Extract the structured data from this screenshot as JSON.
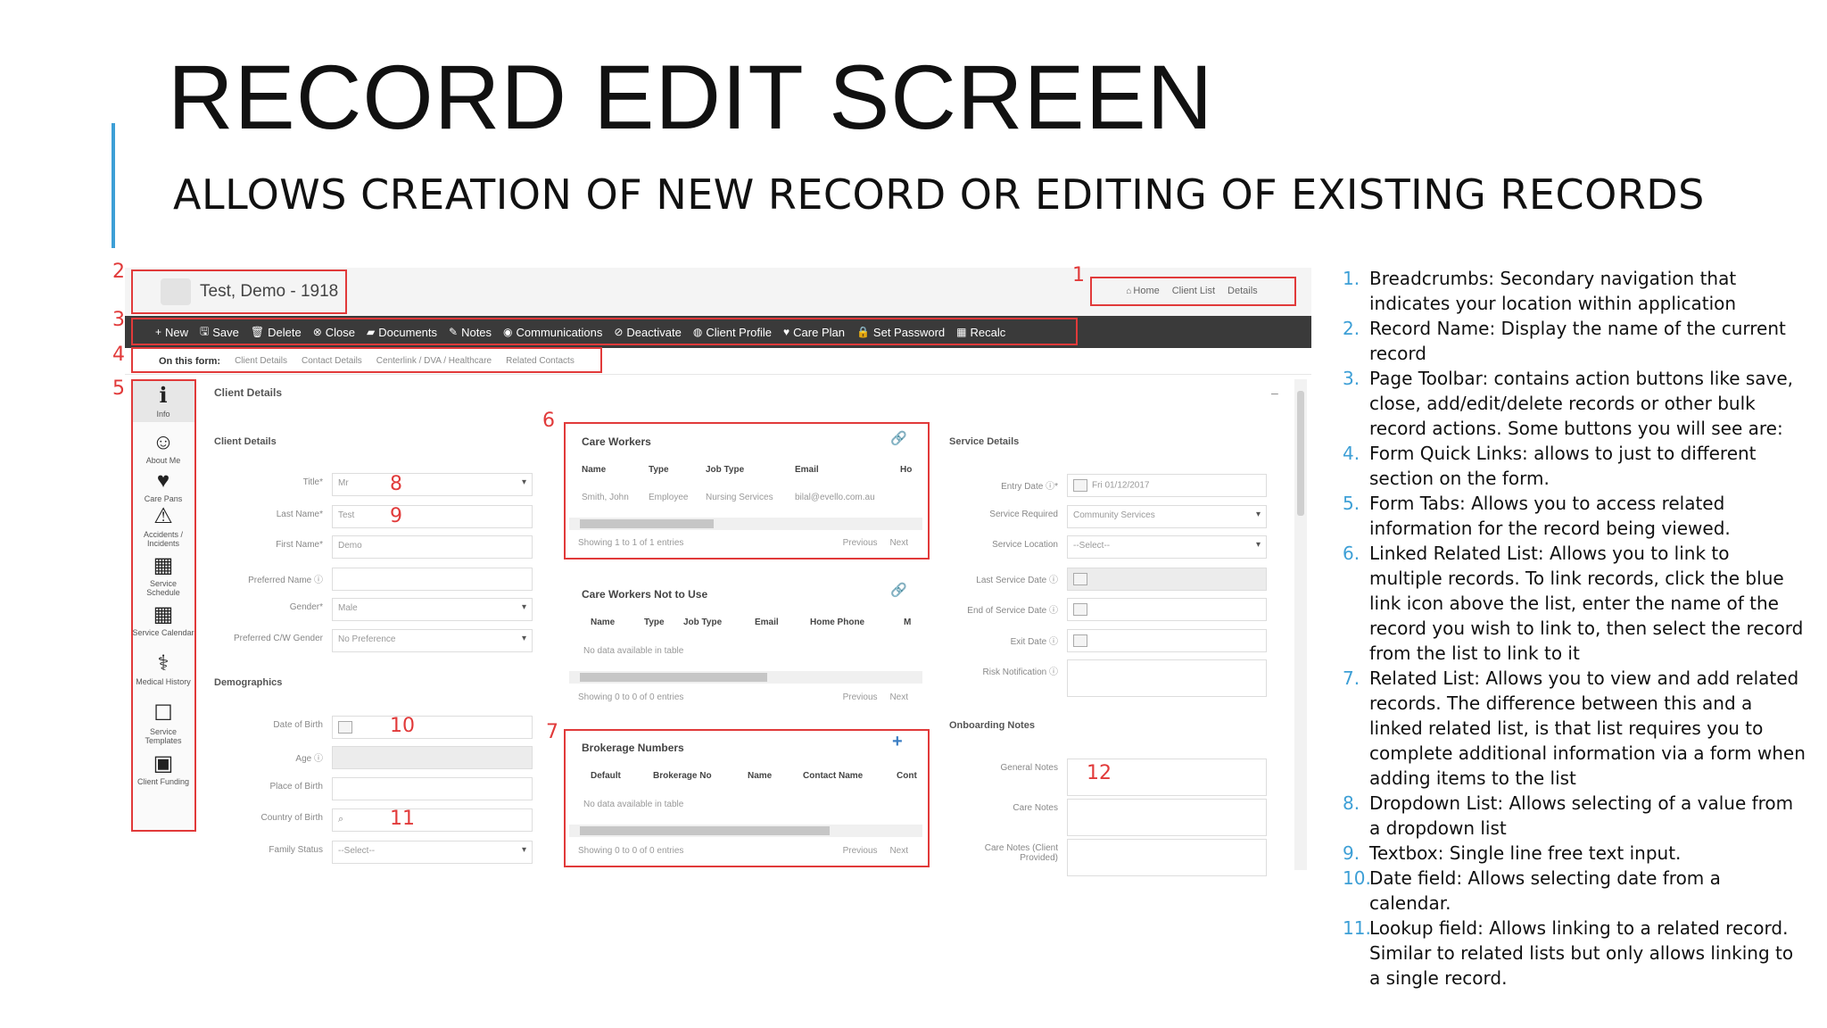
{
  "slide": {
    "title": "RECORD EDIT SCREEN",
    "subtitle": "ALLOWS CREATION OF NEW RECORD OR EDITING OF EXISTING RECORDS"
  },
  "record": {
    "name": "Test, Demo - 1918"
  },
  "breadcrumbs": [
    "Home",
    "Client List",
    "Details"
  ],
  "toolbar": [
    {
      "icon": "plus-icon",
      "glyph": "+",
      "label": "New"
    },
    {
      "icon": "save-icon",
      "glyph": "🖫",
      "label": "Save"
    },
    {
      "icon": "trash-icon",
      "glyph": "🗑",
      "label": "Delete"
    },
    {
      "icon": "close-circle-icon",
      "glyph": "⊗",
      "label": "Close"
    },
    {
      "icon": "folder-icon",
      "glyph": "▰",
      "label": "Documents"
    },
    {
      "icon": "edit-icon",
      "glyph": "✎",
      "label": "Notes"
    },
    {
      "icon": "chat-icon",
      "glyph": "◉",
      "label": "Communications"
    },
    {
      "icon": "ban-icon",
      "glyph": "⊘",
      "label": "Deactivate"
    },
    {
      "icon": "user-circle-icon",
      "glyph": "◍",
      "label": "Client Profile"
    },
    {
      "icon": "heart-icon",
      "glyph": "♥",
      "label": "Care Plan"
    },
    {
      "icon": "lock-icon",
      "glyph": "🔒",
      "label": "Set Password"
    },
    {
      "icon": "calculator-icon",
      "glyph": "▦",
      "label": "Recalc"
    }
  ],
  "quicklinks": {
    "label": "On this form:",
    "links": [
      "Client Details",
      "Contact Details",
      "Centerlink / DVA / Healthcare",
      "Related Contacts"
    ]
  },
  "tabs": [
    {
      "icon": "info-icon",
      "glyph": "ℹ",
      "label": "Info"
    },
    {
      "icon": "user-icon",
      "glyph": "☺",
      "label": "About Me"
    },
    {
      "icon": "heartbeat-icon",
      "glyph": "♥",
      "label": "Care Pans"
    },
    {
      "icon": "warning-icon",
      "glyph": "⚠",
      "label": "Accidents / Incidents"
    },
    {
      "icon": "calendar-icon",
      "glyph": "▦",
      "label": "Service Schedule"
    },
    {
      "icon": "calendar-grid-icon",
      "glyph": "▦",
      "label": "Service Calendar"
    },
    {
      "icon": "medical-icon",
      "glyph": "⚕",
      "label": "Medical History"
    },
    {
      "icon": "template-icon",
      "glyph": "☐",
      "label": "Service Templates"
    },
    {
      "icon": "money-icon",
      "glyph": "▣",
      "label": "Client Funding"
    }
  ],
  "client_details": {
    "panel_title": "Client Details",
    "section_title": "Client Details",
    "fields": [
      {
        "label": "Title*",
        "value": "Mr",
        "type": "select"
      },
      {
        "label": "Last Name*",
        "value": "Test",
        "type": "text"
      },
      {
        "label": "First Name*",
        "value": "Demo",
        "type": "text"
      },
      {
        "label": "Preferred Name ⓘ",
        "value": "",
        "type": "text"
      },
      {
        "label": "Gender*",
        "value": "Male",
        "type": "select"
      },
      {
        "label": "Preferred C/W Gender",
        "value": "No Preference",
        "type": "select"
      }
    ],
    "demographics_title": "Demographics",
    "demographics": [
      {
        "label": "Date of Birth",
        "value": "",
        "type": "date"
      },
      {
        "label": "Age ⓘ",
        "value": "",
        "type": "readonly"
      },
      {
        "label": "Place of Birth",
        "value": "",
        "type": "text"
      },
      {
        "label": "Country of Birth",
        "value": "",
        "type": "lookup"
      },
      {
        "label": "Family Status",
        "value": "--Select--",
        "type": "select"
      }
    ]
  },
  "care_workers": {
    "title": "Care Workers",
    "columns": [
      "Name",
      "Type",
      "Job Type",
      "Email",
      "Ho"
    ],
    "rows": [
      [
        "Smith, John",
        "Employee",
        "Nursing Services",
        "bilal@evello.com.au",
        ""
      ]
    ],
    "showing": "Showing 1 to 1 of 1 entries",
    "previous": "Previous",
    "next": "Next"
  },
  "care_workers_not": {
    "title": "Care Workers Not to Use",
    "columns": [
      "Name",
      "Type",
      "Job Type",
      "Email",
      "Home Phone",
      "M"
    ],
    "empty": "No data available in table",
    "showing": "Showing 0 to 0 of 0 entries",
    "previous": "Previous",
    "next": "Next"
  },
  "brokerage": {
    "title": "Brokerage Numbers",
    "columns": [
      "Default",
      "Brokerage No",
      "Name",
      "Contact Name",
      "Cont"
    ],
    "empty": "No data available in table",
    "showing": "Showing 0 to 0 of 0 entries",
    "previous": "Previous",
    "next": "Next"
  },
  "service_details": {
    "title": "Service Details",
    "fields": [
      {
        "label": "Entry Date ⓘ*",
        "value": "Fri 01/12/2017",
        "type": "date"
      },
      {
        "label": "Service Required",
        "value": "Community Services",
        "type": "select"
      },
      {
        "label": "Service Location",
        "value": "--Select--",
        "type": "select"
      },
      {
        "label": "Last Service Date ⓘ",
        "value": "",
        "type": "date-gray"
      },
      {
        "label": "End of Service Date ⓘ",
        "value": "",
        "type": "date"
      },
      {
        "label": "Exit Date ⓘ",
        "value": "",
        "type": "date"
      },
      {
        "label": "Risk Notification ⓘ",
        "value": "",
        "type": "textarea"
      }
    ],
    "onboarding_title": "Onboarding Notes",
    "notes": [
      {
        "label": "General Notes",
        "value": ""
      },
      {
        "label": "Care Notes",
        "value": ""
      },
      {
        "label": "Care Notes (Client Provided)",
        "value": ""
      }
    ]
  },
  "callouts": [
    "1",
    "2",
    "3",
    "4",
    "5",
    "6",
    "7",
    "8",
    "9",
    "10",
    "11",
    "12"
  ],
  "notes": [
    {
      "num": "1.",
      "text": "Breadcrumbs: Secondary navigation that indicates your location within application"
    },
    {
      "num": "2.",
      "text": "Record Name: Display the name of the current record"
    },
    {
      "num": "3.",
      "text": "Page Toolbar: contains action buttons like save, close, add/edit/delete records or other bulk record actions. Some buttons you will see are:"
    },
    {
      "num": "4.",
      "text": "Form Quick Links: allows to just to different section on the form."
    },
    {
      "num": "5.",
      "text": "Form Tabs: Allows you to access related information for the record being viewed."
    },
    {
      "num": "6.",
      "text": "Linked Related List: Allows you to link to multiple records. To link records, click the blue link icon above the list, enter the name of the record you wish to link to, then select the record from the list to link to it"
    },
    {
      "num": "7.",
      "text": "Related List: Allows you to view and add related records. The difference between this and a linked related list, is that list requires you to complete additional information via a form when adding items to the list"
    },
    {
      "num": "8.",
      "text": "Dropdown List: Allows selecting of a value from a dropdown list"
    },
    {
      "num": "9.",
      "text": "Textbox: Single line free text input."
    },
    {
      "num": "10.",
      "text": "Date field: Allows selecting date from a calendar."
    },
    {
      "num": "11.",
      "text": "Lookup field: Allows linking to a related record. Similar to related lists but only allows linking to a single record."
    }
  ],
  "colors": {
    "accent": "#3d9fd6",
    "callout_red": "#e13a3a",
    "toolbar_bg": "#3a3a3a",
    "link_blue": "#3d7fc4"
  }
}
